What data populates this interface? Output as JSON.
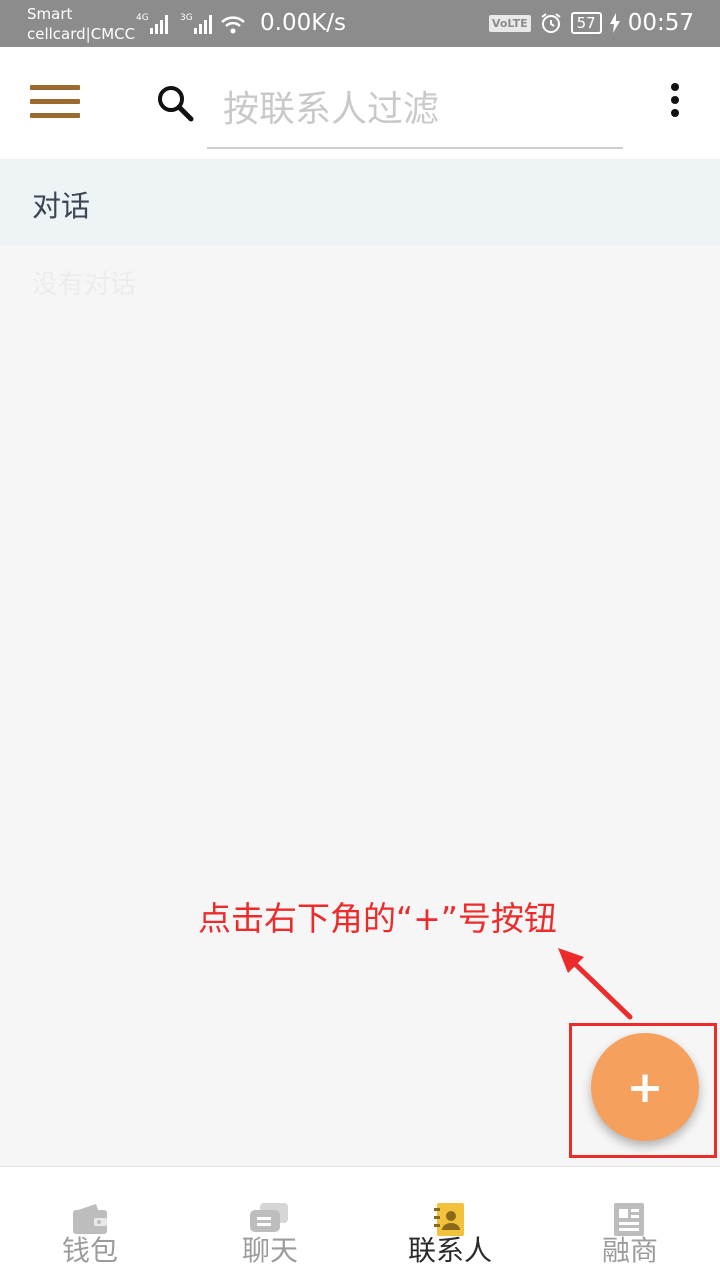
{
  "status_bar": {
    "carrier_line1": "Smart",
    "carrier_line2": "cellcard|CMCC",
    "net1": "4G",
    "net2": "3G",
    "speed": "0.00K/s",
    "volte": "VoLTE",
    "battery": "57",
    "time": "00:57"
  },
  "app_bar": {
    "search_placeholder": "按联系人过滤",
    "icons": {
      "menu": "menu-icon",
      "search": "search-icon",
      "more": "more-vert-icon"
    }
  },
  "conversations": {
    "header": "对话",
    "empty_text": "没有对话"
  },
  "annotation": {
    "text": "点击右下角的“+”号按钮",
    "color": "#ee2b2b"
  },
  "fab": {
    "label": "+",
    "color": "#f5a05c"
  },
  "bottom_nav": {
    "tabs": [
      {
        "label": "钱包",
        "icon": "wallet-icon",
        "active": false
      },
      {
        "label": "聊天",
        "icon": "chat-icon",
        "active": false
      },
      {
        "label": "联系人",
        "icon": "contacts-icon",
        "active": true
      },
      {
        "label": "融商",
        "icon": "news-icon",
        "active": false
      }
    ]
  },
  "colors": {
    "accent": "#9b6a2f",
    "status_bar": "#8c8c8c",
    "section_bg": "#eef3f6"
  }
}
